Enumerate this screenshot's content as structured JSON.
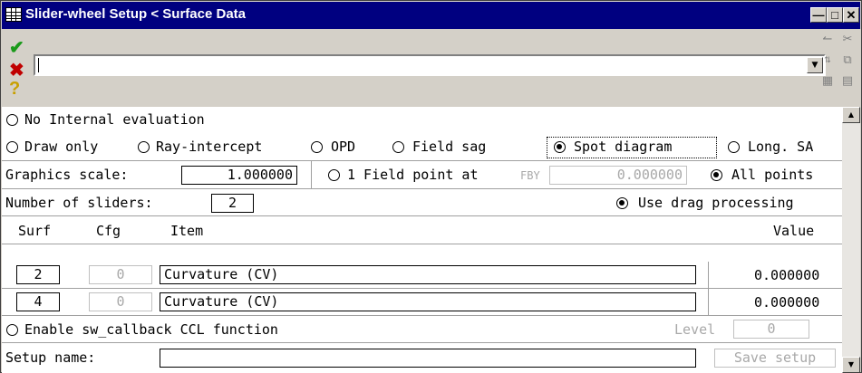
{
  "window": {
    "title": "Slider-wheel Setup < Surface Data",
    "icon": "table-icon",
    "buttons": [
      "minimize-icon",
      "maximize-icon",
      "close-icon"
    ]
  },
  "command_bar": {
    "ok_icon": "checkmark-icon",
    "cancel_icon": "x-icon",
    "help_icon": "question-icon",
    "combo_value": "",
    "side_icons": [
      "undo-icon",
      "cut-icon",
      "sort-icon",
      "copy-icon",
      "grid-icon",
      "paste-icon"
    ]
  },
  "eval_options": {
    "no_internal": "No Internal evaluation",
    "draw_only": "Draw only",
    "ray_intercept": "Ray-intercept",
    "opd": "OPD",
    "field_sag": "Field sag",
    "spot_diagram": "Spot diagram",
    "long_sa": "Long. SA",
    "selected": "spot_diagram"
  },
  "graphics": {
    "scale_label": "Graphics scale:",
    "scale_value": "1.000000",
    "one_field_label": "1 Field point at",
    "fby_label": "FBY",
    "fby_value": "0.000000",
    "all_points_label": "All points",
    "selected": "all_points"
  },
  "sliders": {
    "count_label": "Number of sliders:",
    "count_value": "2",
    "drag_label": "Use drag processing",
    "drag_selected": true
  },
  "table": {
    "headers": {
      "surf": "Surf",
      "cfg": "Cfg",
      "item": "Item",
      "value": "Value"
    },
    "rows": [
      {
        "surf": "2",
        "cfg": "0",
        "item": "Curvature (CV)",
        "value": "0.000000"
      },
      {
        "surf": "4",
        "cfg": "0",
        "item": "Curvature (CV)",
        "value": "0.000000"
      }
    ]
  },
  "callback": {
    "label": "Enable sw_callback CCL function",
    "level_label": "Level",
    "level_value": "0"
  },
  "setup": {
    "name_label": "Setup name:",
    "name_value": "",
    "save_label": "Save setup"
  }
}
